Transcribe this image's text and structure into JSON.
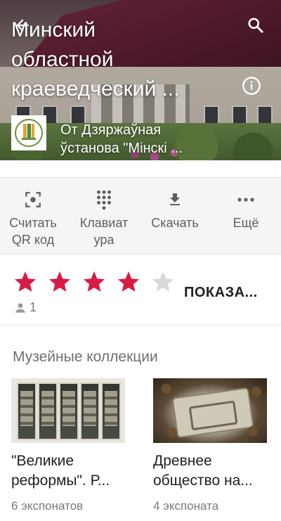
{
  "header": {
    "title_lines": [
      "Минский",
      "областной",
      "краеведческий ..."
    ],
    "owner_lines": [
      "От Дзяржаўная",
      "ўстанова \"Мінскі ..."
    ],
    "icons": {
      "back": "arrow-back-icon",
      "search": "search-icon",
      "info": "info-icon"
    }
  },
  "actions": [
    {
      "icon": "qr-scan-icon",
      "label_lines": [
        "Считать",
        "QR код"
      ]
    },
    {
      "icon": "keypad-icon",
      "label_lines": [
        "Клавиат",
        "ура"
      ]
    },
    {
      "icon": "download-icon",
      "label_lines": [
        "Скачать"
      ]
    },
    {
      "icon": "more-icon",
      "label_lines": [
        "Ещё"
      ]
    }
  ],
  "rating": {
    "value": 4,
    "max": 5,
    "count": "1",
    "show_label": "ПОКАЗА...",
    "star_color": "#d81b45",
    "empty_star_color": "#d9d9d9"
  },
  "collections": {
    "title": "Музейные коллекции",
    "items": [
      {
        "caption_lines": [
          "\"Великие",
          "реформы\". Р..."
        ],
        "meta": "6 экспонатов"
      },
      {
        "caption_lines": [
          "Древнее",
          "общество на..."
        ],
        "meta": "4 экспоната"
      }
    ]
  }
}
